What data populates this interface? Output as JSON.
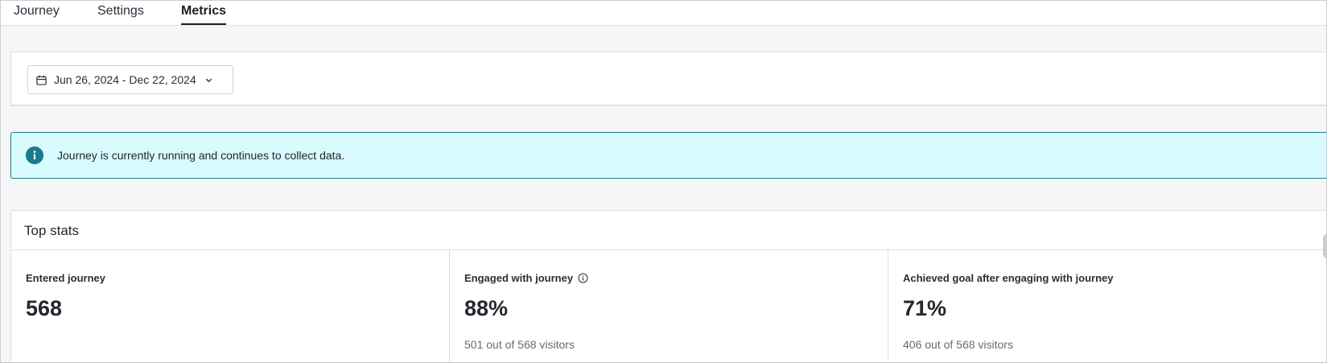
{
  "tabs": [
    {
      "label": "Journey",
      "active": false
    },
    {
      "label": "Settings",
      "active": false
    },
    {
      "label": "Metrics",
      "active": true
    }
  ],
  "date_range": {
    "label": "Jun 26, 2024 - Dec 22, 2024",
    "icon": "calendar-icon",
    "dropdown_icon": "chevron-down-icon"
  },
  "banner": {
    "icon": "info-icon",
    "text": "Journey is currently running and continues to collect data.",
    "bg_color": "#d8fbfd",
    "accent_color": "#1a7c8c"
  },
  "top_stats": {
    "title": "Top stats",
    "items": [
      {
        "label": "Entered journey",
        "value": "568",
        "sub": ""
      },
      {
        "label": "Engaged with journey",
        "value": "88%",
        "sub": "501 out of 568 visitors",
        "has_info_icon": true
      },
      {
        "label": "Achieved goal after engaging with journey",
        "value": "71%",
        "sub": "406 out of 568 visitors"
      }
    ]
  }
}
